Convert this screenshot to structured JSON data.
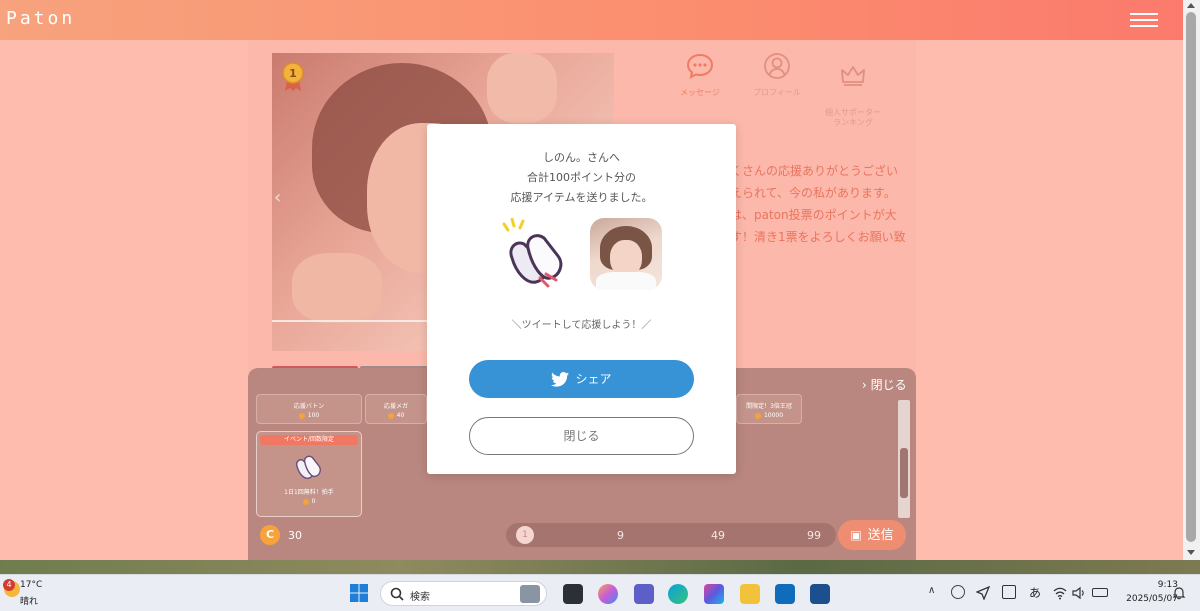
{
  "header": {
    "logo": "Paton"
  },
  "nav": [
    {
      "label": "メッセージ"
    },
    {
      "label": "プロフィール"
    },
    {
      "label": "個人サポーター\nランキング"
    }
  ],
  "profile_text_lines": [
    "くさんの応援ありがとうござい",
    "えられて、今の私があります。",
    "は、paton投票のポイントが大",
    "す！清き1票をよろしくお願い致"
  ],
  "photo": {
    "rank_number": "1"
  },
  "panel": {
    "close_label": "閉じる",
    "items_top": [
      {
        "name": "応援バトン",
        "price": "100"
      },
      {
        "name": "応援メガ",
        "price": "40"
      },
      {
        "name": "間限定！3倍王冠",
        "price": "10000"
      }
    ],
    "event_card": {
      "tag": "イベント/回数限定",
      "name": "1日1回無料！拍手",
      "price": "0"
    },
    "coin_label": "C",
    "coin_count": "30",
    "slider": {
      "value": "1",
      "marks": [
        "9",
        "49",
        "99"
      ]
    },
    "send_label": "送信"
  },
  "modal": {
    "line1": "しのん。さんへ",
    "line2": "合計100ポイント分の",
    "line3": "応援アイテムを送りました。",
    "tweet_prompt": "＼ツイートして応援しよう！／",
    "share_label": "シェア",
    "close_label": "閉じる"
  },
  "taskbar": {
    "weather_badge": "4",
    "weather_temp": "17°C",
    "weather_cond": "晴れ",
    "search_placeholder": "検索",
    "ime": "あ",
    "time": "9:13",
    "date": "2025/05/07"
  },
  "colors": {
    "accent": "#fb8d6e",
    "twitter_blue": "#3792d6",
    "coin": "#f7a23a"
  }
}
